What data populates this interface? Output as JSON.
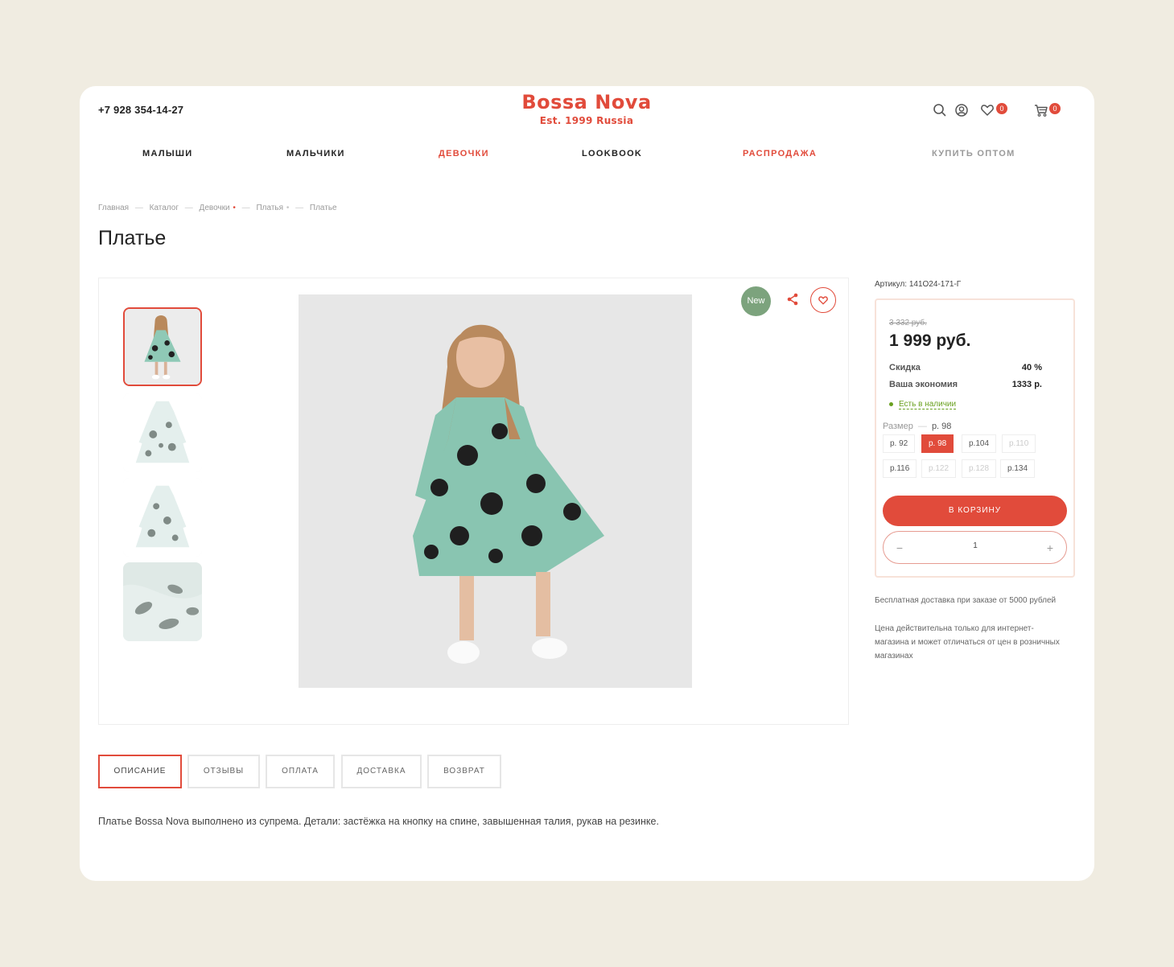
{
  "header": {
    "phone": "+7 928 354-14-27",
    "logo_name": "Bossa Nova",
    "logo_sub": "Est. 1999 Russia",
    "wishlist_count": "0",
    "cart_count": "0"
  },
  "nav": {
    "items": [
      "МАЛЫШИ",
      "МАЛЬЧИКИ",
      "ДЕВОЧКИ",
      "LOOKBOOK",
      "РАСПРОДАЖА",
      "КУПИТЬ ОПТОМ"
    ]
  },
  "breadcrumb": [
    "Главная",
    "Каталог",
    "Девочки",
    "Платья",
    "Платье"
  ],
  "product": {
    "title": "Платье",
    "badge": "New",
    "sku": "Артикул: 141О24-171-Г",
    "old_price": "3 332 руб.",
    "price": "1 999 руб.",
    "discount_label": "Скидка",
    "discount_value": "40 %",
    "saving_label": "Ваша экономия",
    "saving_value": "1333 р.",
    "stock": "Есть в наличии",
    "size_label": "Размер",
    "size_selected": "р. 98",
    "sizes_row1": [
      "р. 92",
      "р. 98",
      "р.104",
      "р.110"
    ],
    "sizes_row2": [
      "р.116",
      "р.122",
      "р.128",
      "р.134"
    ],
    "add_to_cart": "В КОРЗИНУ",
    "qty_minus": "−",
    "qty": "1",
    "qty_plus": "+",
    "delivery_note": "Бесплатная доставка при заказе от 5000 рублей",
    "price_note": "Цена действительна только для интернет-магазина и может отличаться от цен в розничных магазинах"
  },
  "tabs": [
    "ОПИСАНИЕ",
    "ОТЗЫВЫ",
    "ОПЛАТА",
    "ДОСТАВКА",
    "ВОЗВРАТ"
  ],
  "description": "Платье Bossa Nova выполнено из супрема. Детали: застёжка на кнопку на спине, завышенная талия, рукав на резинке.",
  "colors": {
    "accent": "#e14b3b",
    "badge_green": "#7ca37d",
    "stock_green": "#69a01f",
    "background": "#f0ece1"
  }
}
